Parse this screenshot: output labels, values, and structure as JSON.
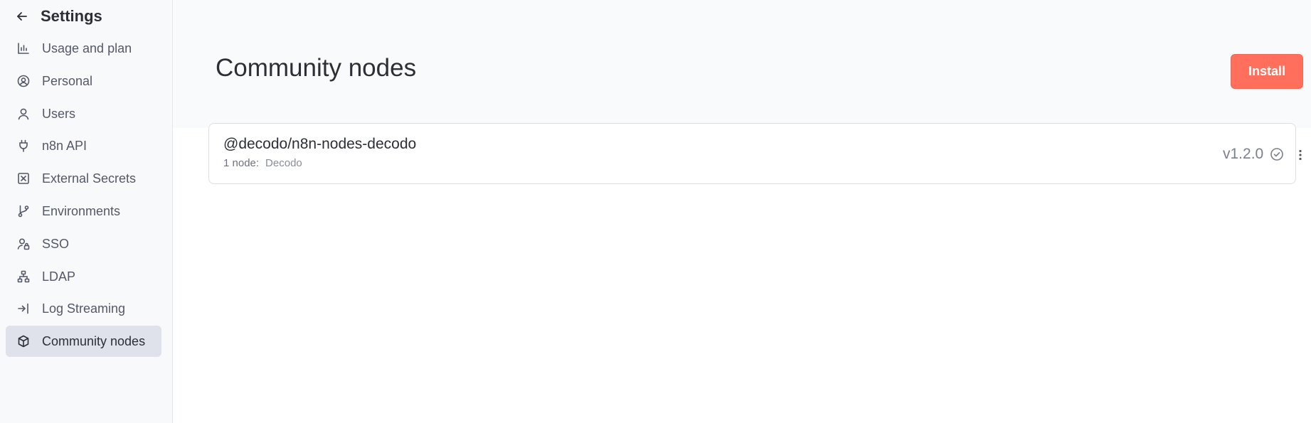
{
  "sidebar": {
    "title": "Settings",
    "items": [
      {
        "label": "Usage and plan",
        "icon": "bar-chart-icon"
      },
      {
        "label": "Personal",
        "icon": "user-circle-icon"
      },
      {
        "label": "Users",
        "icon": "user-icon"
      },
      {
        "label": "n8n API",
        "icon": "plug-icon"
      },
      {
        "label": "External Secrets",
        "icon": "vault-icon"
      },
      {
        "label": "Environments",
        "icon": "git-branch-icon"
      },
      {
        "label": "SSO",
        "icon": "user-lock-icon"
      },
      {
        "label": "LDAP",
        "icon": "network-icon"
      },
      {
        "label": "Log Streaming",
        "icon": "sign-in-icon"
      },
      {
        "label": "Community nodes",
        "icon": "cube-icon",
        "active": true
      }
    ]
  },
  "main": {
    "title": "Community nodes",
    "install_label": "Install",
    "packages": [
      {
        "name": "@decodo/n8n-nodes-decodo",
        "node_count": "1 node:",
        "nodes": "Decodo",
        "version": "v1.2.0"
      }
    ]
  },
  "colors": {
    "accent": "#ff6f5c",
    "sidebar_bg": "#f8f9fb",
    "active_item_bg": "#dfe2ea"
  }
}
